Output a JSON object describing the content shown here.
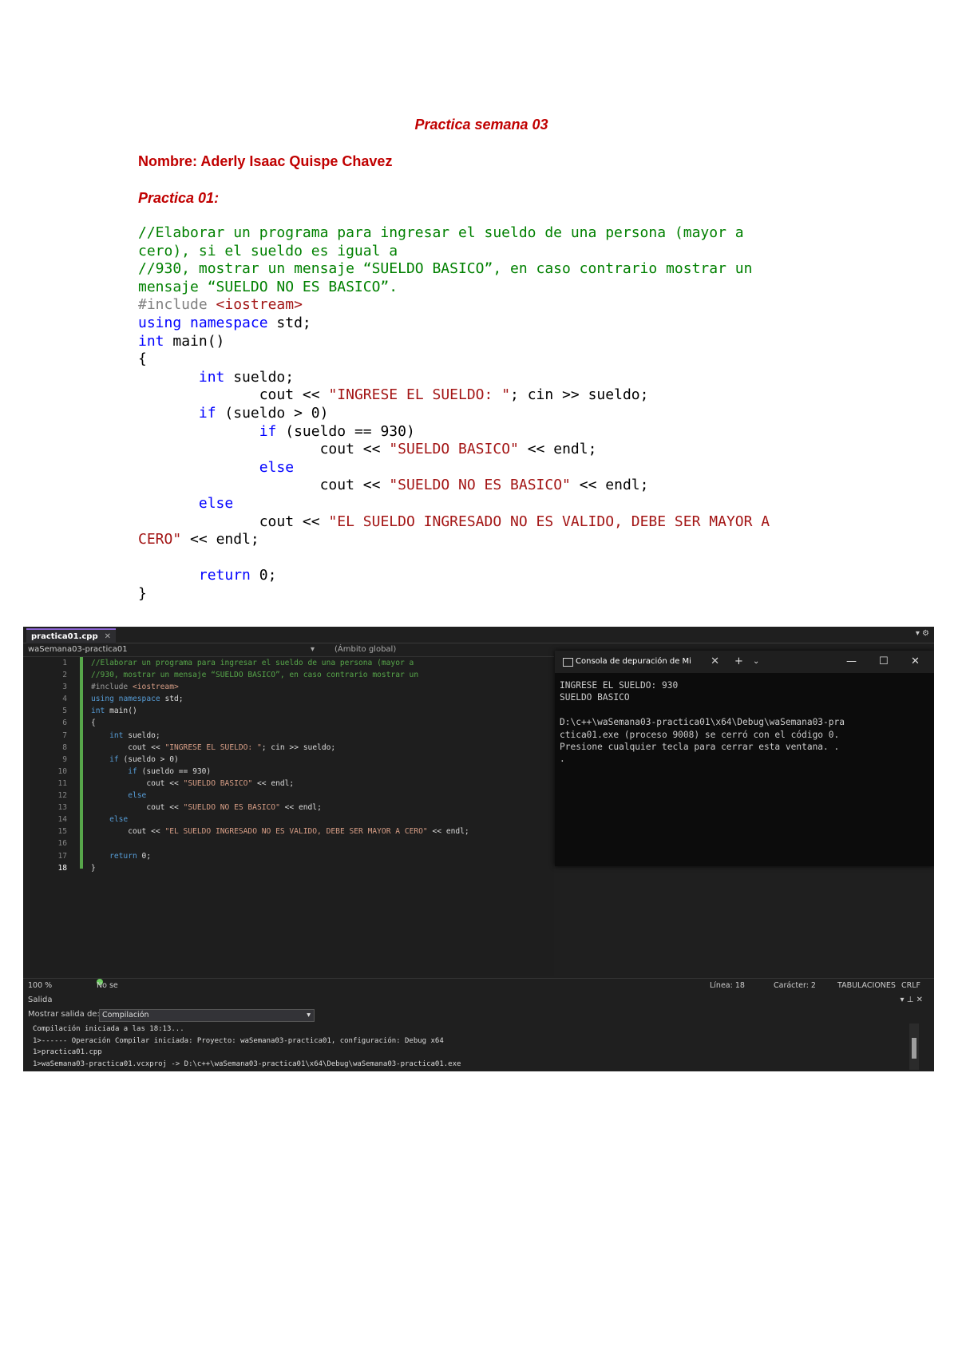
{
  "document": {
    "title": "Practica semana 03",
    "name_line": "Nombre: Aderly Isaac Quispe Chavez",
    "section": "Practica 01:",
    "code": {
      "comment1": "//Elaborar un programa para ingresar el sueldo de una persona (mayor a",
      "comment1b": "cero), si el sueldo es igual a",
      "comment2": "//930, mostrar un mensaje “SUELDO BASICO”, en caso contrario mostrar un",
      "comment2b": "mensaje “SUELDO NO ES BASICO”.",
      "include": "#include",
      "include_lib": "<iostream>",
      "kw_using": "using",
      "kw_namespace": "namespace",
      "std": "std;",
      "kw_int": "int",
      "main": "main()",
      "brace_open": "{",
      "decl": "sueldo;",
      "cout": "cout",
      "op_out": "<<",
      "op_in": ">>",
      "str_ingrese": "\"INGRESE EL SUELDO: \"",
      "cin_part": "; cin",
      "sueldo_end": "sueldo;",
      "kw_if": "if",
      "cond1": "(sueldo > 0)",
      "cond2": "(sueldo == 930)",
      "str_basico": "\"SUELDO BASICO\"",
      "endl": "endl;",
      "kw_else": "else",
      "str_nobasico": "\"SUELDO NO ES BASICO\"",
      "str_invalido_a": "\"EL SUELDO INGRESADO NO ES VALIDO, DEBE SER MAYOR A",
      "str_invalido_b": "CERO\"",
      "kw_return": "return",
      "ret_val": "0;",
      "brace_close": "}"
    }
  },
  "ide": {
    "file_tab": "practica01.cpp",
    "project_dropdown": "waSemana03-practica01",
    "scope_dropdown": "(Ámbito global)",
    "line_numbers": [
      "1",
      "2",
      "3",
      "4",
      "5",
      "6",
      "7",
      "8",
      "9",
      "10",
      "11",
      "12",
      "13",
      "14",
      "15",
      "16",
      "17",
      "18"
    ],
    "zoom": "100 %",
    "problems": "No se encontraron problemas.",
    "line_info": "Línea: 18",
    "char_info": "Carácter: 2",
    "tabs_info": "TABULACIONES",
    "eol": "CRLF",
    "output_title": "Salida",
    "output_label": "Mostrar salida de:",
    "output_source": "Compilación",
    "output_lines": [
      "Compilación iniciada a las 18:13...",
      "1>------ Operación Compilar iniciada: Proyecto: waSemana03-practica01, configuración: Debug x64",
      "1>practica01.cpp",
      "1>waSemana03-practica01.vcxproj -> D:\\c++\\waSemana03-practica01\\x64\\Debug\\waSemana03-practica01.exe"
    ]
  },
  "console": {
    "tab_title": "Consola de depuración de Mi",
    "lines": [
      "INGRESE EL SUELDO: 930",
      "SUELDO BASICO",
      "",
      "D:\\c++\\waSemana03-practica01\\x64\\Debug\\waSemana03-pra",
      "ctica01.exe (proceso 9008) se cerró con el código 0.",
      "Presione cualquier tecla para cerrar esta ventana. .",
      "."
    ]
  }
}
